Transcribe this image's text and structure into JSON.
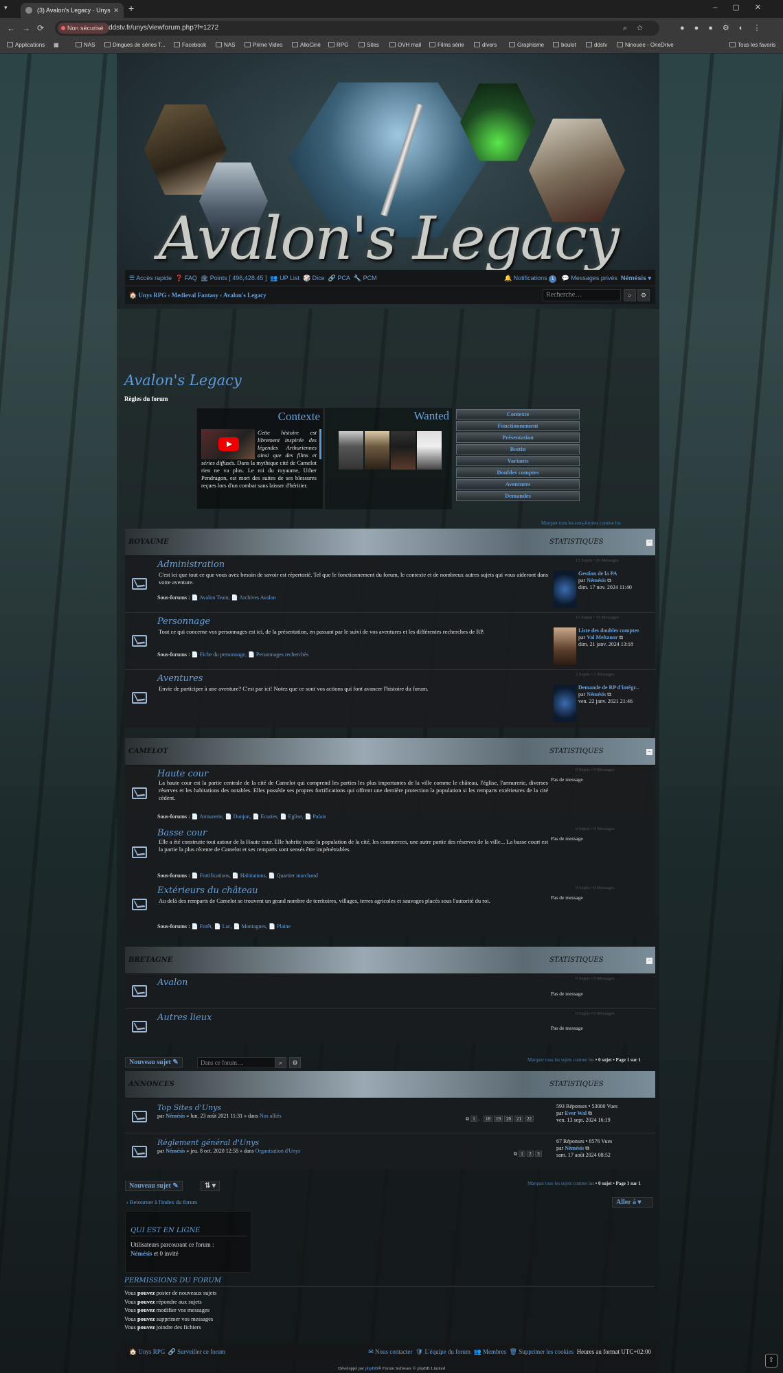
{
  "browser": {
    "tab_title": "(3) Avalon's Legacy · Unys",
    "security": "Non sécurisé",
    "url": "ddstv.fr/unys/viewforum.php?f=1272",
    "bookmarks": [
      "Applications",
      "NAS",
      "Dingues de séries T...",
      "Facebook",
      "NAS",
      "Prime Video",
      "AlloCiné",
      "RPG",
      "Sites",
      "OVH mail",
      "Films série",
      "divers",
      "Graphisme",
      "boulot",
      "ddstv",
      "Ninouee - OneDrive",
      "Tous les favoris"
    ]
  },
  "banner": {
    "logo": "Avalon's Legacy"
  },
  "navbar": {
    "quick": "☰ Accès rapide",
    "faq": "❓ FAQ",
    "points": "🏛 Points [ 496,428.45 ]",
    "up_list": "👥 UP List",
    "dice": "🎲 Dice",
    "pca": "🔗 PCA",
    "pcm": "🔧 PCM",
    "notifications": "🔔 Notifications",
    "notif_count": "1",
    "messages": "💬 Messages privés",
    "user": "Némésis ▾",
    "crumbs": [
      "Unys RPG",
      "Medieval Fantasy",
      "Avalon's Legacy"
    ],
    "search_placeholder": "Recherche…"
  },
  "forum": {
    "title": "Avalon's Legacy",
    "rules": "Règles du forum",
    "contexte_title": "Contexte",
    "contexte_text_italic": "Cette histoire est librement inspirée des légendes Arthuriennes ainsi que des films et séries diffusés.",
    "contexte_text": "Dans la mythique cité de Camelot rien ne va plus. Le roi du royaume, Uther Pendragon, est mort des suites de ses blessures reçues lors d'un combat sans laisser d'héritier.",
    "wanted_title": "Wanted",
    "menu": [
      "Contexte",
      "Fonctionnement",
      "Présentation",
      "Bottin",
      "Variants",
      "Doubles comptes",
      "Aventures",
      "Demandes"
    ],
    "mark_subforums": "Marquer tous les sous-forums comme lus"
  },
  "categories": [
    {
      "name": "ROYAUME",
      "stats_label": "STATISTIQUES",
      "collapse": "−",
      "rows": [
        {
          "title": "Administration",
          "desc": "C'est ici que tout ce que vous avez besoin de savoir est répertorié. Tel que le fonctionnement du forum, le contexte et de nombreux autres sujets qui vous aideront dans votre aventure.",
          "sub_label": "Sous-forums :",
          "subs": "📄 Avalon Team, 📄 Archives Avalon",
          "stats": "13 Sujets • 20 Messages",
          "lp_title": "Gestion de la PA",
          "lp_by": "par",
          "lp_user": "Némésis",
          "lp_date": "dim. 17 nov. 2024 11:40"
        },
        {
          "title": "Personnage",
          "desc": "Tout ce qui concerne vos personnages est ici, de la présentation, en passant par le suivi de vos aventures et les différentes recherches de RP.",
          "sub_label": "Sous-forums :",
          "subs": "📄 Fiche du personnage, 📄 Personnages recherchés",
          "stats": "13 Sujets • 15 Messages",
          "lp_title": "Liste des doubles comptes",
          "lp_by": "par",
          "lp_user": "Val Meltanor",
          "lp_date": "dim. 21 janv. 2024 13:18"
        },
        {
          "title": "Aventures",
          "desc": "Envie de participer à une aventure? C'est par ici! Notez que ce sont vos actions qui font avancer l'histoire du forum.",
          "sub_label": "",
          "subs": "",
          "stats": "2 Sujets • 2 Messages",
          "lp_title": "Demande de RP d'intégr...",
          "lp_by": "par",
          "lp_user": "Némésis",
          "lp_date": "ven. 22 janv. 2021 21:46"
        }
      ]
    },
    {
      "name": "CAMELOT",
      "stats_label": "STATISTIQUES",
      "collapse": "−",
      "rows": [
        {
          "title": "Haute cour",
          "desc": "La haute cour est la partie centrale de la cité de Camelot qui comprend les parties les plus importantes de la ville comme le château, l'église, l'armurerie, diverses réserves et les habitations des notables. Elles possède ses propres fortifications qui offrent une dernière protection la population si les remparts extérieures de la cité cèdent.",
          "sub_label": "Sous-forums :",
          "subs": "📄 Armurerie, 📄 Donjon, 📄 Ecuries, 📄 Eglise, 📄 Palais",
          "stats": "0 Sujets • 0 Messages",
          "nomsg": "Pas de message"
        },
        {
          "title": "Basse cour",
          "desc": "Elle a été construite tout autour de la Haute cour. Elle habrite toute la population de la cité, les commerces, une autre partie des réserves de la ville... La basse court est la partie la plus récente de Camelot et ses remparts sont sensés être impénétrables.",
          "sub_label": "Sous-forums :",
          "subs": "📄 Fortifications, 📄 Habitations, 📄 Quartier marchand",
          "stats": "0 Sujets • 0 Messages",
          "nomsg": "Pas de message"
        },
        {
          "title": "Extérieurs du château",
          "desc": "Au delà des remparts de Camelot se trouvent un grand nombre de territoires, villages, terres agricoles et sauvages placés sous l'autorité du roi.",
          "sub_label": "Sous-forums :",
          "subs": "📄 Forêt, 📄 Lac, 📄 Montagnes, 📄 Plaine",
          "stats": "0 Sujets • 0 Messages",
          "nomsg": "Pas de message"
        }
      ]
    },
    {
      "name": "BRETAGNE",
      "stats_label": "STATISTIQUES",
      "collapse": "−",
      "rows": [
        {
          "title": "Avalon",
          "stats": "0 Sujets • 0 Messages",
          "nomsg": "Pas de message"
        },
        {
          "title": "Autres lieux",
          "stats": "0 Sujets • 0 Messages",
          "nomsg": "Pas de message"
        }
      ]
    }
  ],
  "topics": {
    "new_topic": "Nouveau sujet ✎",
    "search_placeholder": "Dans ce forum…",
    "mark_read": "Marquer tous les sujets comme lus",
    "count": "• 0 sujet • Page",
    "page": "1",
    "of": "sur",
    "pages": "1",
    "header": "ANNONCES",
    "stats_label": "STATISTIQUES",
    "rows": [
      {
        "title": "Top Sites d'Unys",
        "by": "par",
        "user": "Némésis",
        "date": "» lun. 23 août 2021 11:31 » dans",
        "forum": "Nos alliés",
        "pages": [
          "1",
          "…",
          "18",
          "19",
          "20",
          "21",
          "22"
        ],
        "replies": "593 Réponses • 53000 Vues",
        "lp_by": "par",
        "lp_user": "Ever Wal",
        "lp_date": "ven. 13 sept. 2024 16:19"
      },
      {
        "title": "Règlement général d'Unys",
        "by": "par",
        "user": "Némésis",
        "date": "» jeu. 8 oct. 2020 12:58 » dans",
        "forum": "Organisation d'Unys",
        "pages": [
          "1",
          "2",
          "3"
        ],
        "replies": "67 Réponses • 8576 Vues",
        "lp_by": "par",
        "lp_user": "Némésis",
        "lp_date": "sam. 17 août 2024 08:52"
      }
    ],
    "sort_btn": "⇅ ▾",
    "back": "‹  Retourner à l'index du forum",
    "jump": "Aller à  ▾"
  },
  "whois": {
    "title": "QUI EST EN LIGNE",
    "text": "Utilisateurs parcourant ce forum :",
    "user": "Némésis",
    "guests": "et 0 invité"
  },
  "permissions": {
    "title": "PERMISSIONS DU FORUM",
    "lines": [
      {
        "pre": "Vous",
        "b": "pouvez",
        "post": "poster de nouveaux sujets"
      },
      {
        "pre": "Vous",
        "b": "pouvez",
        "post": "répondre aux sujets"
      },
      {
        "pre": "Vous",
        "b": "pouvez",
        "post": "modifier vos messages"
      },
      {
        "pre": "Vous",
        "b": "pouvez",
        "post": "supprimer vos messages"
      },
      {
        "pre": "Vous",
        "b": "pouvez",
        "post": "joindre des fichiers"
      }
    ]
  },
  "footer": {
    "home": "🏠 Unys RPG",
    "watch": "🔗 Surveiller ce forum",
    "contact": "✉ Nous contacter",
    "team": "🛡 L'équipe du forum",
    "members": "👥 Membres",
    "cookies": "🗑 Supprimer les cookies",
    "tz": "Heures au format UTC+02:00",
    "credit_pre": "Développé par",
    "credit_link": "phpBB",
    "credit_post": "® Forum Software © phpBB Limited"
  },
  "colors": {
    "link": "#6aa0d8",
    "accent": "#5e9ad8"
  }
}
